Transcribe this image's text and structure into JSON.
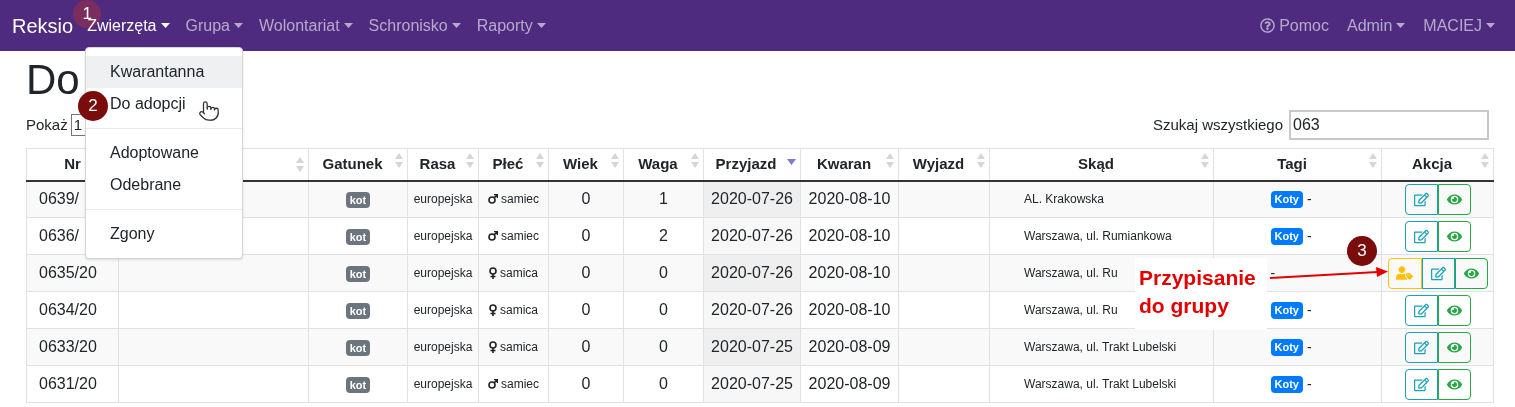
{
  "navbar": {
    "brand": "Reksio",
    "items": [
      {
        "label": "Zwierzęta",
        "selected": true
      },
      {
        "label": "Grupa",
        "selected": false
      },
      {
        "label": "Wolontariat",
        "selected": false
      },
      {
        "label": "Schronisko",
        "selected": false
      },
      {
        "label": "Raporty",
        "selected": false
      }
    ],
    "right": [
      {
        "label": "Pomoc",
        "kind": "help"
      },
      {
        "label": "Admin",
        "kind": "dropdown"
      },
      {
        "label": "MACIEJ",
        "kind": "dropdown"
      }
    ]
  },
  "dropdown": {
    "groups": [
      [
        {
          "label": "Kwarantanna",
          "selected": true
        },
        {
          "label": "Do adopcji",
          "selected": false
        }
      ],
      [
        {
          "label": "Adoptowane",
          "selected": false
        },
        {
          "label": "Odebrane",
          "selected": false
        }
      ],
      [
        {
          "label": "Zgony",
          "selected": false
        }
      ]
    ]
  },
  "page_title": "Do",
  "length": {
    "label": "Pokaż",
    "value": "1"
  },
  "search": {
    "label": "Szukaj wszystkiego",
    "value": "063"
  },
  "table": {
    "columns": [
      {
        "label": "Nr"
      },
      {
        "sortable": true,
        "sorted_desc": false
      },
      {
        "label": "Gatunek",
        "sortable": true,
        "sorted_desc": false
      },
      {
        "label": "Rasa",
        "sortable": true,
        "sorted_desc": false
      },
      {
        "label": "Płeć",
        "sortable": true,
        "sorted_desc": false
      },
      {
        "label": "Wiek",
        "sortable": true,
        "sorted_desc": false
      },
      {
        "label": "Waga",
        "sortable": true,
        "sorted_desc": false
      },
      {
        "label": "Przyjazd",
        "sortable": true,
        "sorted_desc": true
      },
      {
        "label": "Kwaran",
        "sortable": true,
        "sorted_desc": false
      },
      {
        "label": "Wyjazd",
        "sortable": true,
        "sorted_desc": false
      },
      {
        "label": "Skąd",
        "sortable": true,
        "sorted_desc": false
      },
      {
        "label": "Tagi",
        "sortable": true,
        "sorted_desc": false
      },
      {
        "label": "Akcja",
        "sortable": true,
        "sorted_desc": false
      }
    ],
    "rows": [
      {
        "nr": "0639/",
        "species": "kot",
        "breed": "europejska",
        "kind": "male",
        "sex_label": "samiec",
        "age": "0",
        "weight": "1",
        "arrival": "2020-07-26",
        "quarantine": "2020-08-10",
        "from": "AL. Krakowska",
        "tags": [
          "Koty"
        ],
        "tag_note": "-",
        "assign_group": false
      },
      {
        "nr": "0636/",
        "species": "kot",
        "breed": "europejska",
        "kind": "male",
        "sex_label": "samiec",
        "age": "0",
        "weight": "2",
        "arrival": "2020-07-26",
        "quarantine": "2020-08-10",
        "from": "Warszawa, ul. Rumiankowa",
        "tags": [
          "Koty"
        ],
        "tag_note": "-",
        "assign_group": false
      },
      {
        "nr": "0635/20",
        "species": "kot",
        "breed": "europejska",
        "kind": "female",
        "sex_label": "samica",
        "age": "0",
        "weight": "0",
        "arrival": "2020-07-26",
        "quarantine": "2020-08-10",
        "from": "Warszawa, ul. Ru",
        "tags": [],
        "tag_note": "-",
        "assign_group": true
      },
      {
        "nr": "0634/20",
        "species": "kot",
        "breed": "europejska",
        "kind": "female",
        "sex_label": "samica",
        "age": "0",
        "weight": "0",
        "arrival": "2020-07-26",
        "quarantine": "2020-08-10",
        "from": "Warszawa, ul. Ru",
        "tags": [
          "Koty"
        ],
        "tag_note": "-",
        "assign_group": false
      },
      {
        "nr": "0633/20",
        "species": "kot",
        "breed": "europejska",
        "kind": "female",
        "sex_label": "samica",
        "age": "0",
        "weight": "0",
        "arrival": "2020-07-25",
        "quarantine": "2020-08-09",
        "from": "Warszawa, ul. Trakt Lubelski",
        "tags": [
          "Koty"
        ],
        "tag_note": "-",
        "assign_group": false
      },
      {
        "nr": "0631/20",
        "species": "kot",
        "breed": "europejska",
        "kind": "male",
        "sex_label": "samiec",
        "age": "0",
        "weight": "0",
        "arrival": "2020-07-25",
        "quarantine": "2020-08-09",
        "from": "Warszawa, ul. Trakt Lubelski",
        "tags": [
          "Koty"
        ],
        "tag_note": "-",
        "assign_group": false
      }
    ]
  },
  "annotations": {
    "markers": [
      "1",
      "2",
      "3"
    ],
    "callout": "Przypisanie do grupy"
  }
}
